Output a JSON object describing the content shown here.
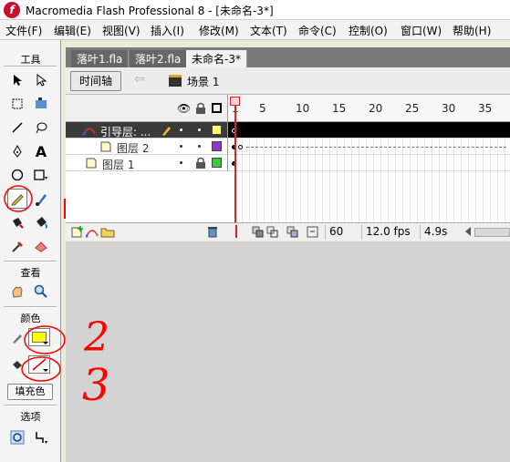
{
  "window": {
    "title": "Macromedia Flash Professional 8 - [未命名-3*]",
    "app_icon_glyph": "f"
  },
  "menu": [
    "文件(F)",
    "编辑(E)",
    "视图(V)",
    "插入(I)",
    "修改(M)",
    "文本(T)",
    "命令(C)",
    "控制(O)",
    "窗口(W)",
    "帮助(H)"
  ],
  "tools_panel": {
    "title": "工具",
    "view_title": "查看",
    "color_title": "颜色",
    "fill_label": "填充色",
    "options_title": "选项",
    "fill_color": "#ffff00"
  },
  "doc_tabs": [
    {
      "label": "落叶1.fla",
      "active": false
    },
    {
      "label": "落叶2.fla",
      "active": false
    },
    {
      "label": "未命名-3*",
      "active": true
    }
  ],
  "edit_bar": {
    "timeline_button": "时间轴",
    "scene_label": "场景 1"
  },
  "timeline": {
    "frame_numbers": [
      "1",
      "5",
      "10",
      "15",
      "20",
      "25",
      "30",
      "35"
    ],
    "layers": [
      {
        "name": "引导层: ...",
        "selected": true,
        "color": "#ffff66"
      },
      {
        "name": "图层 2",
        "selected": false,
        "color": "#9933cc"
      },
      {
        "name": "图层 1",
        "selected": false,
        "color": "#33cc33"
      }
    ],
    "current_frame": "60",
    "fps": "12.0 fps",
    "elapsed": "4.9s"
  },
  "annotations": {
    "mark_2": "2",
    "mark_3": "3",
    "color": "#ff0000"
  }
}
